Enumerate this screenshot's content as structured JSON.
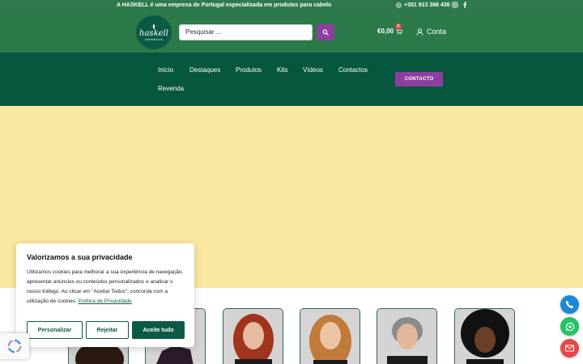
{
  "topbar": {
    "announcement": "A HASKELL é uma empresa de Portugal especializada em produtos para cabelo",
    "phone": "+351 913 386 436",
    "social": [
      "instagram-icon",
      "facebook-icon"
    ]
  },
  "header": {
    "logo_brand": "haskell",
    "logo_sub": "cosméticos",
    "search_placeholder": "Pesquisar ...",
    "cart_total": "€0,00",
    "cart_count": "0",
    "account_label": "Conta"
  },
  "nav": {
    "items": [
      "Início",
      "Destaques",
      "Produtos",
      "Kits",
      "Vídeos",
      "Contactos",
      "Revenda"
    ],
    "contact_button": "CONTACTO"
  },
  "cookie": {
    "title": "Valorizamos a sua privacidade",
    "text": "Utilizamos cookies para melhorar a sua experiência de navegação, apresentar anúncios ou conteúdos personalizados e analisar o nosso tráfego. Ao clicar em \"Aceitar Todos\", concorda com a utilização de cookies.",
    "policy_link": "Política de Privacidade",
    "buttons": {
      "customize": "Personalizar",
      "reject": "Rejeitar",
      "accept": "Aceite tudo"
    }
  },
  "colors": {
    "topbar": "#2f7a4c",
    "nav": "#07573f",
    "accent": "#8c3fa0",
    "hero": "#fae8a0"
  },
  "floating": [
    "phone-icon",
    "whatsapp-icon",
    "mail-icon"
  ]
}
